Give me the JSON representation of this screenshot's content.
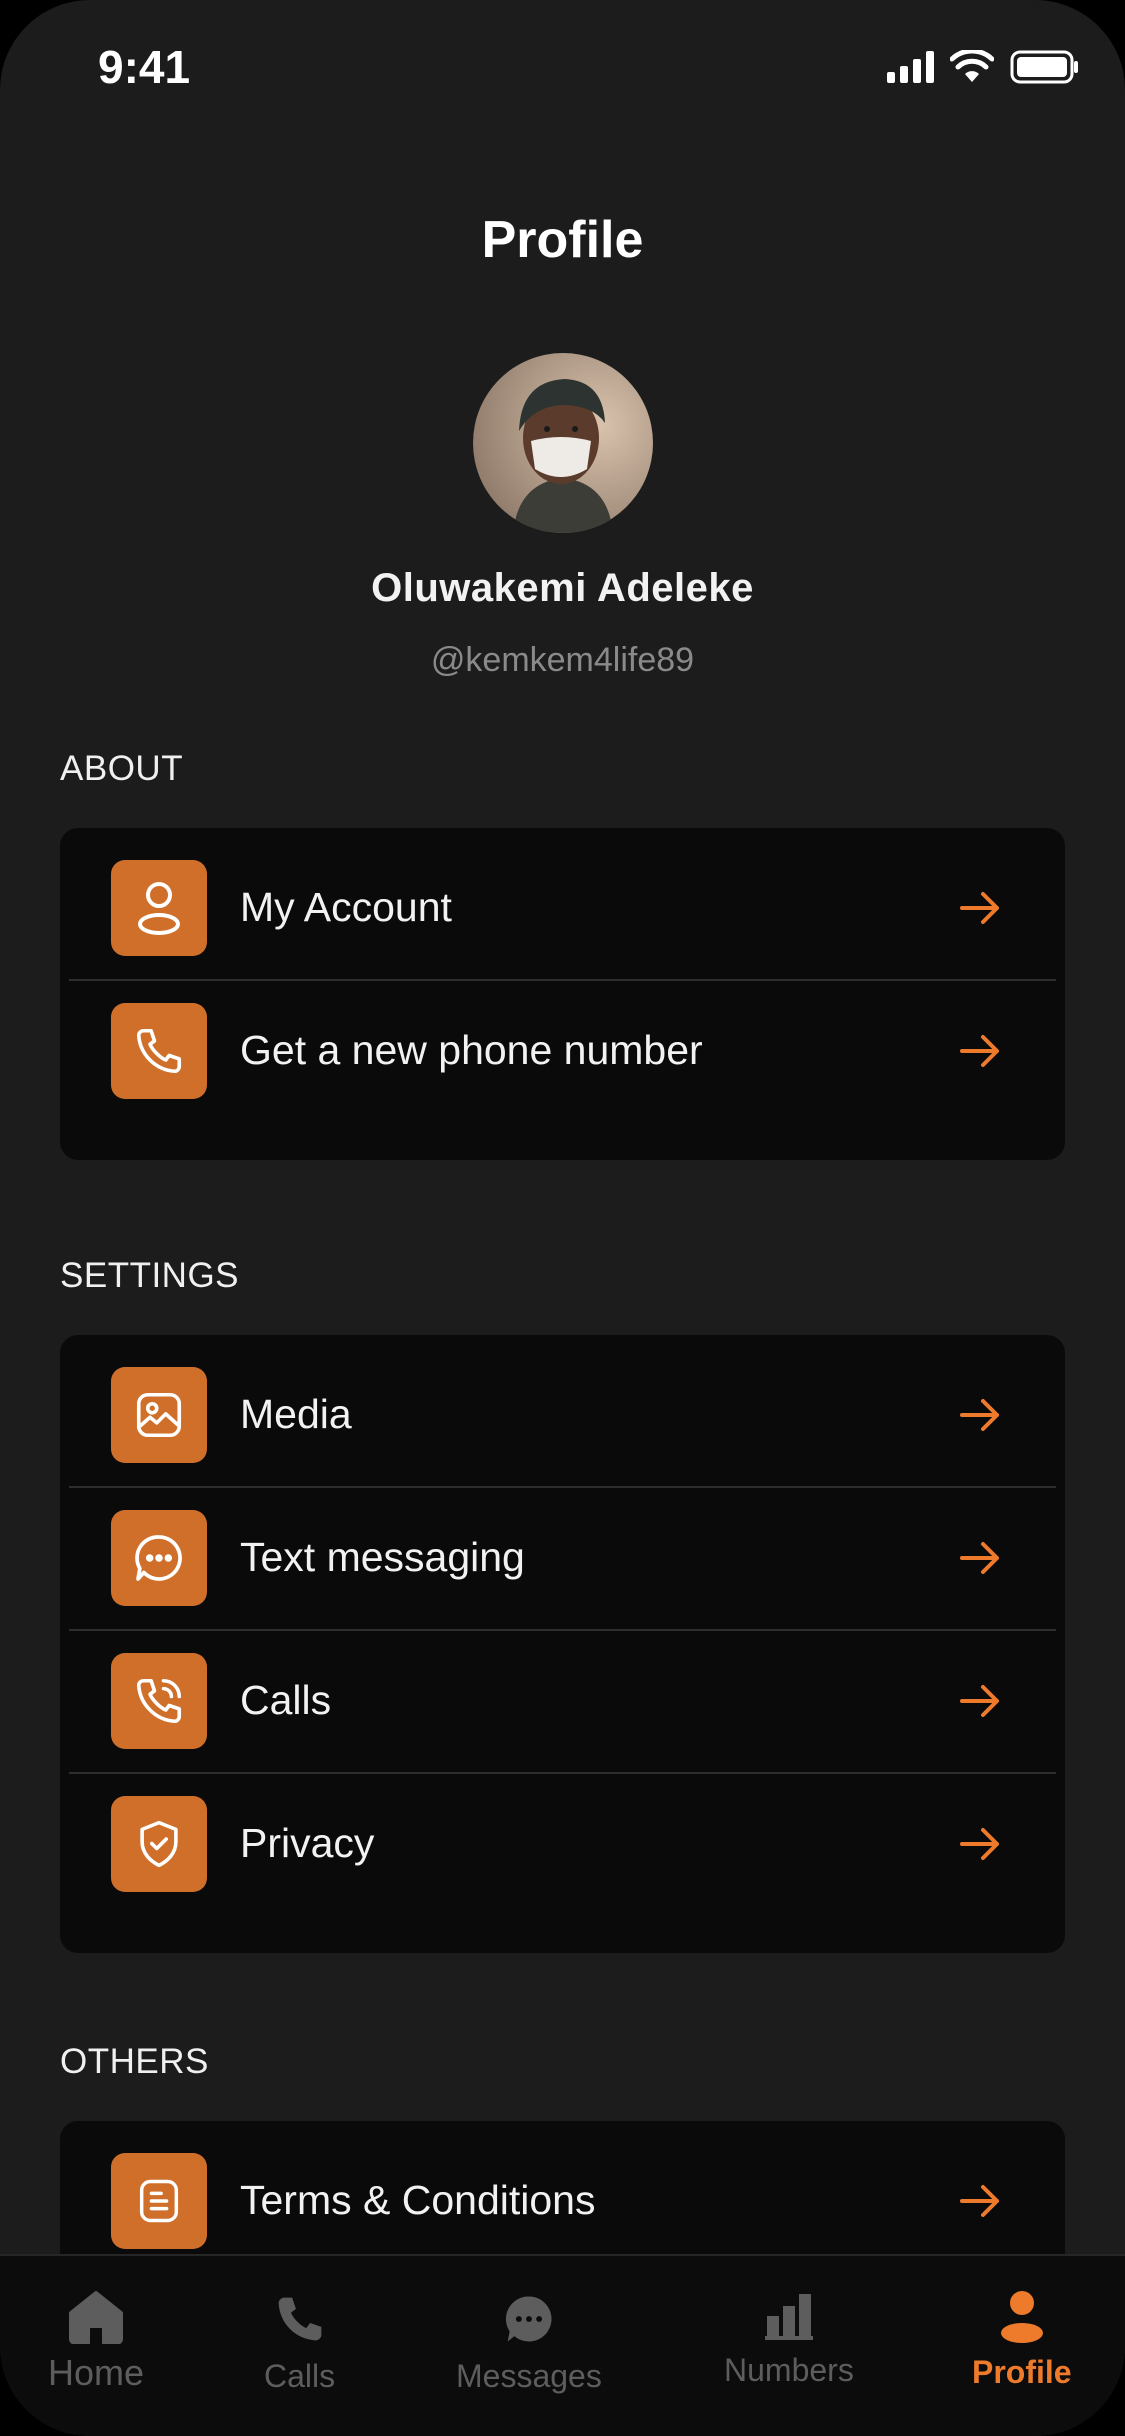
{
  "status_bar": {
    "time": "9:41"
  },
  "header": {
    "title": "Profile"
  },
  "profile": {
    "name": "Oluwakemi Adeleke",
    "handle": "@kemkem4life89"
  },
  "sections": {
    "about": {
      "label": "ABOUT",
      "items": [
        {
          "label": "My Account",
          "icon": "user-icon"
        },
        {
          "label": "Get a new phone number",
          "icon": "phone-icon"
        }
      ]
    },
    "settings": {
      "label": "SETTINGS",
      "items": [
        {
          "label": "Media",
          "icon": "image-icon"
        },
        {
          "label": "Text messaging",
          "icon": "chat-bubble-icon"
        },
        {
          "label": "Calls",
          "icon": "phone-ringing-icon"
        },
        {
          "label": "Privacy",
          "icon": "shield-check-icon"
        }
      ]
    },
    "others": {
      "label": "OTHERS",
      "items": [
        {
          "label": "Terms & Conditions",
          "icon": "document-icon"
        }
      ]
    }
  },
  "tabbar": {
    "tabs": [
      {
        "label": "Home",
        "icon": "home-icon"
      },
      {
        "label": "Calls",
        "icon": "phone-icon"
      },
      {
        "label": "Messages",
        "icon": "chat-bubble-icon"
      },
      {
        "label": "Numbers",
        "icon": "bar-chart-icon"
      },
      {
        "label": "Profile",
        "icon": "person-icon",
        "active": true
      }
    ]
  },
  "colors": {
    "accent": "#d06f2a",
    "accent_text": "#ee7b2c",
    "background": "#1c1c1c",
    "card": "#0a0a0a"
  }
}
